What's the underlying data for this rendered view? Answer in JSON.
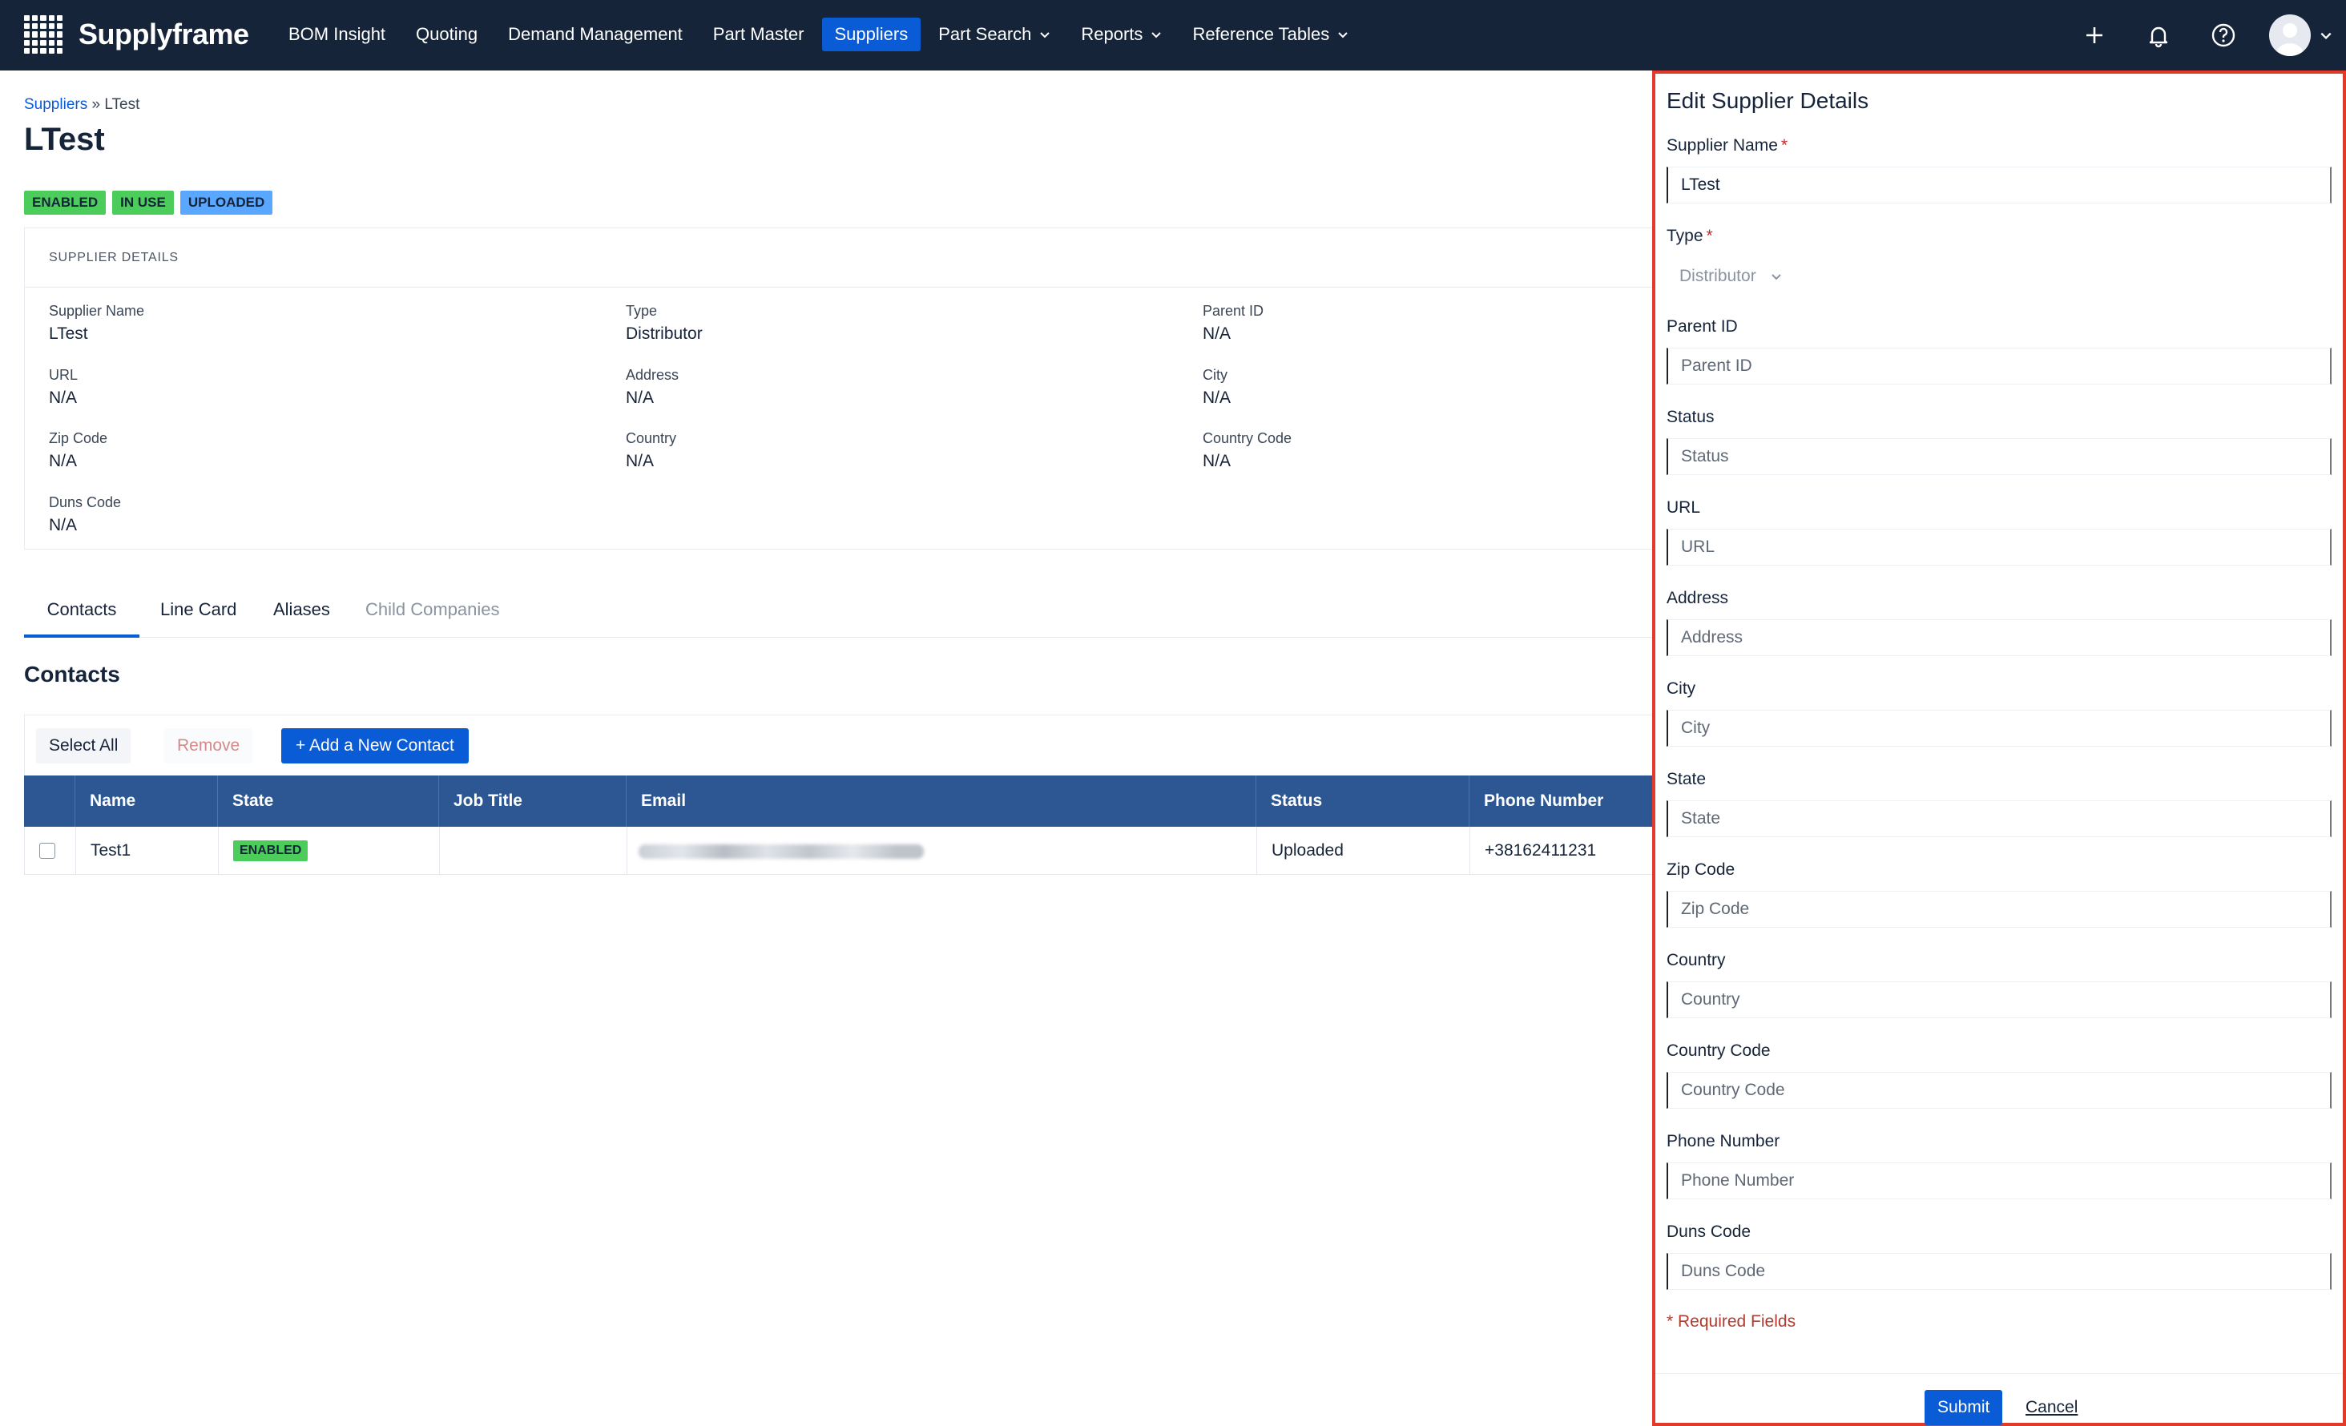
{
  "app": {
    "brand": "Supplyframe",
    "nav": [
      {
        "label": "BOM Insight",
        "has_menu": false,
        "active": false
      },
      {
        "label": "Quoting",
        "has_menu": false,
        "active": false
      },
      {
        "label": "Demand Management",
        "has_menu": false,
        "active": false
      },
      {
        "label": "Part Master",
        "has_menu": false,
        "active": false
      },
      {
        "label": "Suppliers",
        "has_menu": false,
        "active": true
      },
      {
        "label": "Part Search",
        "has_menu": true,
        "active": false
      },
      {
        "label": "Reports",
        "has_menu": true,
        "active": false
      },
      {
        "label": "Reference Tables",
        "has_menu": true,
        "active": false
      }
    ],
    "icons": [
      "plus-icon",
      "bell-icon",
      "help-icon",
      "avatar"
    ],
    "accent": "#0a5bd6",
    "nav_bg": "#16243a"
  },
  "breadcrumb": {
    "parent": "Suppliers",
    "separator": "»",
    "current": "LTest"
  },
  "page": {
    "title": "LTest",
    "badges": [
      {
        "label": "ENABLED",
        "color": "#4ccc5a"
      },
      {
        "label": "IN USE",
        "color": "#4ccc5a"
      },
      {
        "label": "UPLOADED",
        "color": "#5aa7ff"
      }
    ]
  },
  "details": {
    "heading": "SUPPLIER DETAILS",
    "fields": [
      {
        "label": "Supplier Name",
        "value": "LTest"
      },
      {
        "label": "Type",
        "value": "Distributor"
      },
      {
        "label": "Parent ID",
        "value": "N/A"
      },
      {
        "label": "URL",
        "value": "N/A"
      },
      {
        "label": "Address",
        "value": "N/A"
      },
      {
        "label": "City",
        "value": "N/A"
      },
      {
        "label": "Zip Code",
        "value": "N/A"
      },
      {
        "label": "Country",
        "value": "N/A"
      },
      {
        "label": "Country Code",
        "value": "N/A"
      },
      {
        "label": "Duns Code",
        "value": "N/A"
      }
    ]
  },
  "tabs": [
    {
      "label": "Contacts",
      "active": true
    },
    {
      "label": "Line Card",
      "active": false
    },
    {
      "label": "Aliases",
      "active": false
    },
    {
      "label": "Child Companies",
      "active": false,
      "disabled": true
    }
  ],
  "contacts": {
    "title": "Contacts",
    "toolbar": {
      "select_all": "Select All",
      "remove": "Remove",
      "add": "Add a New Contact"
    },
    "columns": [
      "Name",
      "State",
      "Job Title",
      "Email",
      "Status",
      "Phone Number"
    ],
    "rows": [
      {
        "name": "Test1",
        "state": "ENABLED",
        "job_title": "",
        "email": "",
        "status": "Uploaded",
        "phone": "+38162411231"
      }
    ]
  },
  "edit_panel": {
    "title": "Edit Supplier Details",
    "fields": [
      {
        "label": "Supplier Name",
        "required": true,
        "value": "LTest",
        "placeholder": ""
      },
      {
        "label": "Type",
        "required": true,
        "value": "Distributor",
        "kind": "select"
      },
      {
        "label": "Parent ID",
        "required": false,
        "value": "",
        "placeholder": "Parent ID"
      },
      {
        "label": "Status",
        "required": false,
        "value": "",
        "placeholder": "Status"
      },
      {
        "label": "URL",
        "required": false,
        "value": "",
        "placeholder": "URL"
      },
      {
        "label": "Address",
        "required": false,
        "value": "",
        "placeholder": "Address"
      },
      {
        "label": "City",
        "required": false,
        "value": "",
        "placeholder": "City"
      },
      {
        "label": "State",
        "required": false,
        "value": "",
        "placeholder": "State"
      },
      {
        "label": "Zip Code",
        "required": false,
        "value": "",
        "placeholder": "Zip Code"
      },
      {
        "label": "Country",
        "required": false,
        "value": "",
        "placeholder": "Country"
      },
      {
        "label": "Country Code",
        "required": false,
        "value": "",
        "placeholder": "Country Code"
      },
      {
        "label": "Phone Number",
        "required": false,
        "value": "",
        "placeholder": "Phone Number"
      },
      {
        "label": "Duns Code",
        "required": false,
        "value": "",
        "placeholder": "Duns Code"
      }
    ],
    "required_marker": "*",
    "required_note": "* Required Fields",
    "submit": "Submit",
    "cancel": "Cancel",
    "highlight_color": "#e23a2a"
  }
}
